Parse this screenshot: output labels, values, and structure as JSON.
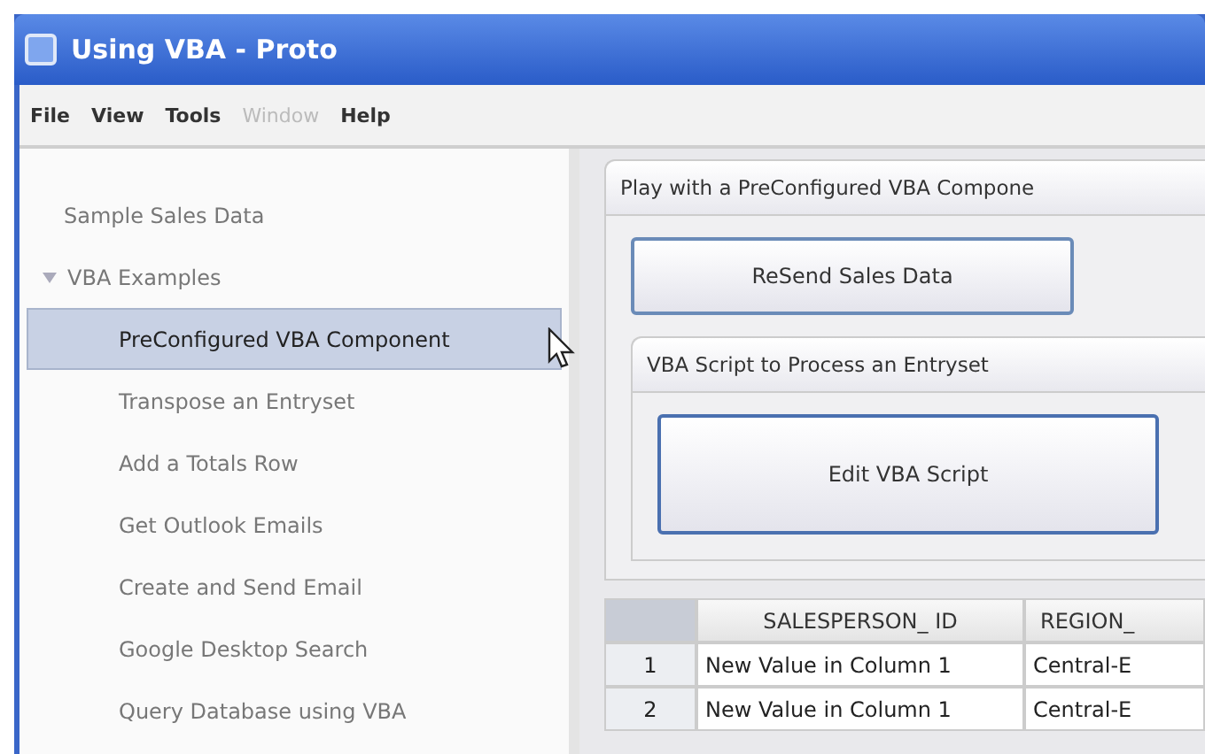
{
  "window": {
    "title": "Using VBA  - Proto"
  },
  "menu": [
    {
      "label": "File",
      "disabled": false
    },
    {
      "label": "View",
      "disabled": false
    },
    {
      "label": "Tools",
      "disabled": false
    },
    {
      "label": "Window",
      "disabled": true
    },
    {
      "label": "Help",
      "disabled": false
    }
  ],
  "sidebar": {
    "items": [
      {
        "label": "Sample Sales Data",
        "selected": false
      },
      {
        "label": "VBA Examples",
        "selected": false,
        "expanded": true,
        "children": [
          {
            "label": "PreConfigured VBA Component",
            "selected": true
          },
          {
            "label": "Transpose an Entryset",
            "selected": false
          },
          {
            "label": "Add a Totals Row",
            "selected": false
          },
          {
            "label": "Get Outlook Emails",
            "selected": false
          },
          {
            "label": "Create and Send Email",
            "selected": false
          },
          {
            "label": "Google Desktop Search",
            "selected": false
          },
          {
            "label": "Query Database using VBA",
            "selected": false
          }
        ]
      }
    ]
  },
  "panel": {
    "title": "Play with a PreConfigured VBA Compone",
    "button": "ReSend Sales Data",
    "group": {
      "title": "VBA Script to Process an Entryset",
      "button": "Edit VBA Script"
    }
  },
  "table": {
    "columns": [
      "SALESPERSON_ ID",
      "REGION_"
    ],
    "rows": [
      {
        "number": "1",
        "cells": [
          "New Value in Column 1",
          "Central-E"
        ]
      },
      {
        "number": "2",
        "cells": [
          "New Value in Column 1",
          "Central-E"
        ]
      }
    ]
  }
}
